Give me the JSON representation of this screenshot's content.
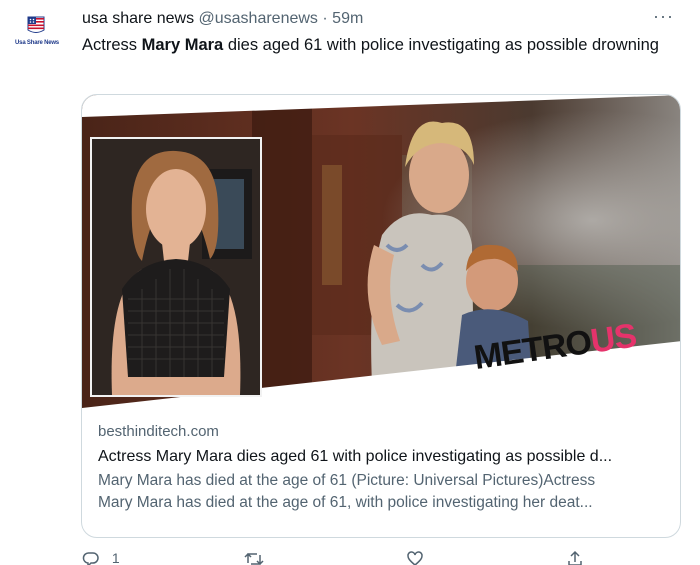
{
  "account": {
    "brand_text": "Usa Share News",
    "display_name": "usa share news",
    "handle": "@usasharenews",
    "separator": "·",
    "time": "59m"
  },
  "tweet": {
    "text_before": "Actress ",
    "text_bold": "Mary Mara",
    "text_after": " dies aged 61 with police investigating as possible drowning"
  },
  "card": {
    "watermark_part1": "METRO",
    "watermark_part2": "US",
    "domain": "besthinditech.com",
    "title": "Actress Mary Mara dies aged 61 with police investigating as possible d...",
    "description_line1": "Mary Mara has died at the age of 61 (Picture: Universal Pictures)Actress",
    "description_line2": "Mary Mara has died at the age of 61, with police investigating her deat..."
  },
  "actions": {
    "reply_count": "1",
    "reply_icon": "reply-icon",
    "retweet_icon": "retweet-icon",
    "like_icon": "heart-icon",
    "share_icon": "share-icon"
  },
  "colors": {
    "text_primary": "#0f1419",
    "text_secondary": "#536471",
    "border": "#cfd9de",
    "metro_pink": "#e5336b"
  }
}
